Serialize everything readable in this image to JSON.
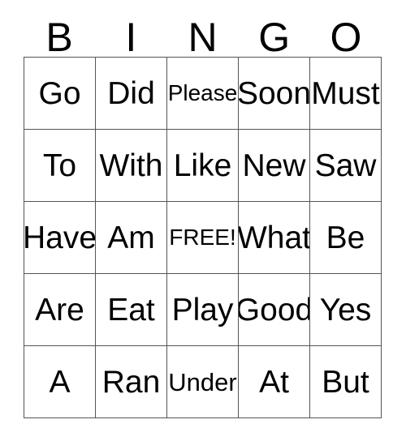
{
  "card": {
    "title": "Bingo Card",
    "header_letters": [
      "B",
      "I",
      "N",
      "G",
      "O"
    ],
    "colors": {
      "background": "#ffffff",
      "text": "#000000",
      "grid_line": "#555555"
    },
    "grid": {
      "columns": 5,
      "rows": 5,
      "rows_data": [
        [
          {
            "text": "Go",
            "size": "size-lg"
          },
          {
            "text": "Did",
            "size": "size-lg"
          },
          {
            "text": "Please",
            "size": "size-sm"
          },
          {
            "text": "Soon",
            "size": "size-lg"
          },
          {
            "text": "Must",
            "size": "size-lg"
          }
        ],
        [
          {
            "text": "To",
            "size": "size-lg"
          },
          {
            "text": "With",
            "size": "size-lg"
          },
          {
            "text": "Like",
            "size": "size-lg"
          },
          {
            "text": "New",
            "size": "size-lg"
          },
          {
            "text": "Saw",
            "size": "size-lg"
          }
        ],
        [
          {
            "text": "Have",
            "size": "size-lg"
          },
          {
            "text": "Am",
            "size": "size-lg"
          },
          {
            "text": "FREE!",
            "size": "size-sm"
          },
          {
            "text": "What",
            "size": "size-lg"
          },
          {
            "text": "Be",
            "size": "size-lg"
          }
        ],
        [
          {
            "text": "Are",
            "size": "size-lg"
          },
          {
            "text": "Eat",
            "size": "size-lg"
          },
          {
            "text": "Play",
            "size": "size-lg"
          },
          {
            "text": "Good",
            "size": "size-lg"
          },
          {
            "text": "Yes",
            "size": "size-lg"
          }
        ],
        [
          {
            "text": "A",
            "size": "size-lg"
          },
          {
            "text": "Ran",
            "size": "size-lg"
          },
          {
            "text": "Under",
            "size": "size-md"
          },
          {
            "text": "At",
            "size": "size-lg"
          },
          {
            "text": "But",
            "size": "size-lg"
          }
        ]
      ]
    }
  }
}
